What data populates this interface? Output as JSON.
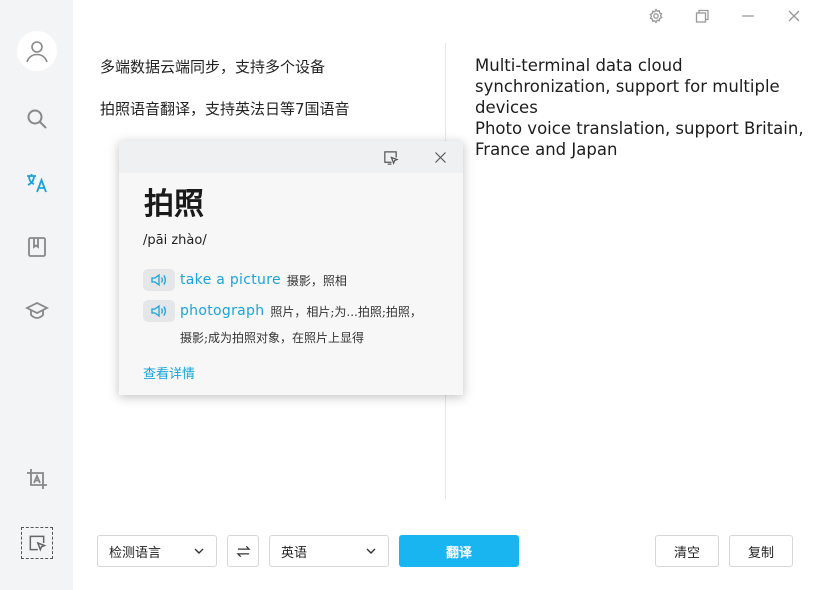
{
  "sidebar": {
    "items": [
      {
        "name": "user",
        "icon": "user-icon",
        "active": false
      },
      {
        "name": "search",
        "icon": "search-icon",
        "active": false
      },
      {
        "name": "translate",
        "icon": "translate-icon",
        "active": true
      },
      {
        "name": "book",
        "icon": "book-icon",
        "active": false
      },
      {
        "name": "learn",
        "icon": "graduation-cap-icon",
        "active": false
      },
      {
        "name": "ocr",
        "icon": "image-text-icon",
        "active": false
      },
      {
        "name": "screen-select",
        "icon": "screen-select-icon",
        "active": false
      }
    ],
    "accent": "#1aa3dc"
  },
  "window": {
    "controls": [
      "gear-icon",
      "restore-icon",
      "minimize-icon",
      "close-icon"
    ]
  },
  "source": {
    "lines": [
      "多端数据云端同步，支持多个设备",
      "拍照语音翻译，支持英法日等7国语音"
    ]
  },
  "target": {
    "paragraphs": [
      "Multi-terminal data cloud synchronization, support for multiple devices",
      "Photo voice translation, support Britain, France and Japan"
    ]
  },
  "popup": {
    "word": "拍照",
    "phonetic": "/pāi zhào/",
    "definitions": [
      {
        "en": "take a picture",
        "zh": "摄影，照相"
      },
      {
        "en": "photograph",
        "zh": "照片，相片;为...拍照;拍照，"
      }
    ],
    "definition_continuation": "摄影;成为拍照对象，在照片上显得",
    "details_link": "查看详情"
  },
  "toolbar": {
    "source_lang": "检测语言",
    "target_lang": "英语",
    "translate_label": "翻译",
    "clear_label": "清空",
    "copy_label": "复制",
    "primary_color": "#19b5f0"
  }
}
